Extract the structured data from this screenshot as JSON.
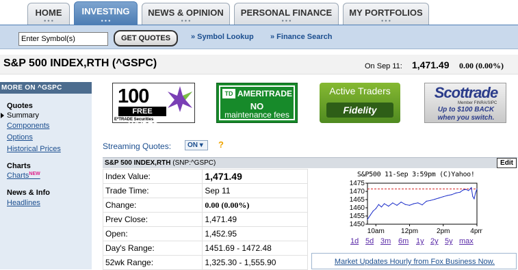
{
  "nav": {
    "tabs": [
      {
        "label": "HOME"
      },
      {
        "label": "INVESTING"
      },
      {
        "label": "NEWS & OPINION"
      },
      {
        "label": "PERSONAL FINANCE"
      },
      {
        "label": "MY PORTFOLIOS"
      }
    ],
    "active_tab": "INVESTING",
    "tab_indicator": "● ● ●"
  },
  "subnav": {
    "symbol_value": "Enter Symbol(s)",
    "get_quotes_label": "GET QUOTES",
    "symbol_lookup": "» Symbol Lookup",
    "finance_search": "» Finance Search"
  },
  "quote": {
    "title": "S&P 500 INDEX,RTH (^GSPC)",
    "date_label": "On Sep 11:",
    "price": "1,471.49",
    "change": "0.00 (0.00%)"
  },
  "sidebar": {
    "header": "MORE ON ^GSPC",
    "quotes_heading": "Quotes",
    "summary": "Summary",
    "components": "Components",
    "options": "Options",
    "historical": "Historical Prices",
    "charts_heading": "Charts",
    "charts_link": "Charts",
    "new_badge": "NEW",
    "news_heading": "News & Info",
    "headlines": "Headlines"
  },
  "ads": {
    "etrade": {
      "big": "100",
      "sub": "FREE TRADES",
      "tiny": "E*TRADE Securities"
    },
    "ameritrade": {
      "logo": "TD",
      "brand": "AMERITRADE",
      "line1": "NO",
      "line2": "maintenance fees"
    },
    "fidelity": {
      "header": "Active Traders",
      "brand": "Fidelity"
    },
    "scottrade": {
      "brand": "Scottrade",
      "member": "Member FINRA/SIPC",
      "line1": "Up to $100 BACK",
      "line2": "when you switch."
    }
  },
  "streaming": {
    "label": "Streaming Quotes:",
    "toggle": "ON ▾",
    "help": "?"
  },
  "table": {
    "title": "S&P 500 INDEX,RTH",
    "subtitle": "(SNP:^GSPC)",
    "edit_label": "Edit",
    "rows": [
      {
        "label": "Index Value:",
        "value": "1,471.49"
      },
      {
        "label": "Trade Time:",
        "value": "Sep 11"
      },
      {
        "label": "Change:",
        "value": "0.00 (0.00%)"
      },
      {
        "label": "Prev Close:",
        "value": "1,471.49"
      },
      {
        "label": "Open:",
        "value": "1,452.95"
      },
      {
        "label": "Day's Range:",
        "value": "1451.69 - 1472.48"
      },
      {
        "label": "52wk Range:",
        "value": "1,325.30 - 1,555.90"
      }
    ]
  },
  "chart": {
    "title": "S&P500 11-Sep 3:59pm (C)Yahoo!",
    "ranges": [
      "1d",
      "5d",
      "3m",
      "6m",
      "1y",
      "2y",
      "5y",
      "max"
    ],
    "line_color": "#1a2cc9",
    "prev_close_color": "#d42020"
  },
  "chart_data": {
    "type": "line",
    "title": "S&P500 11-Sep 3:59pm (C)Yahoo!",
    "xlabel": "",
    "ylabel": "",
    "ylim": [
      1450,
      1475
    ],
    "yticks": [
      1450,
      1455,
      1460,
      1465,
      1470,
      1475
    ],
    "xticks": [
      "10am",
      "12pm",
      "2pm",
      "4pm"
    ],
    "reference_line": {
      "name": "Prev Close",
      "value": 1471.49
    },
    "series": [
      {
        "x": [
          "9:30",
          "9:40",
          "9:50",
          "10:00",
          "10:10",
          "10:20",
          "10:30",
          "10:45",
          "11:00",
          "11:15",
          "11:30",
          "11:45",
          "12:00",
          "12:15",
          "12:30",
          "12:45",
          "13:00",
          "13:15",
          "13:30",
          "13:45",
          "14:00",
          "14:15",
          "14:30",
          "14:45",
          "15:00",
          "15:10",
          "15:20",
          "15:30",
          "15:40",
          "15:45",
          "15:50",
          "15:55",
          "16:00"
        ],
        "values": [
          1452.9,
          1455.5,
          1458.0,
          1459.5,
          1462.0,
          1460.5,
          1462.5,
          1461.0,
          1463.0,
          1461.5,
          1463.5,
          1462.0,
          1461.5,
          1462.5,
          1463.0,
          1461.8,
          1464.0,
          1464.5,
          1465.2,
          1466.0,
          1466.8,
          1467.5,
          1468.0,
          1469.0,
          1469.5,
          1470.8,
          1471.2,
          1470.5,
          1472.3,
          1467.0,
          1465.5,
          1469.0,
          1471.5
        ]
      }
    ]
  },
  "fox": {
    "link": "Market Updates Hourly from Fox Business Now."
  }
}
